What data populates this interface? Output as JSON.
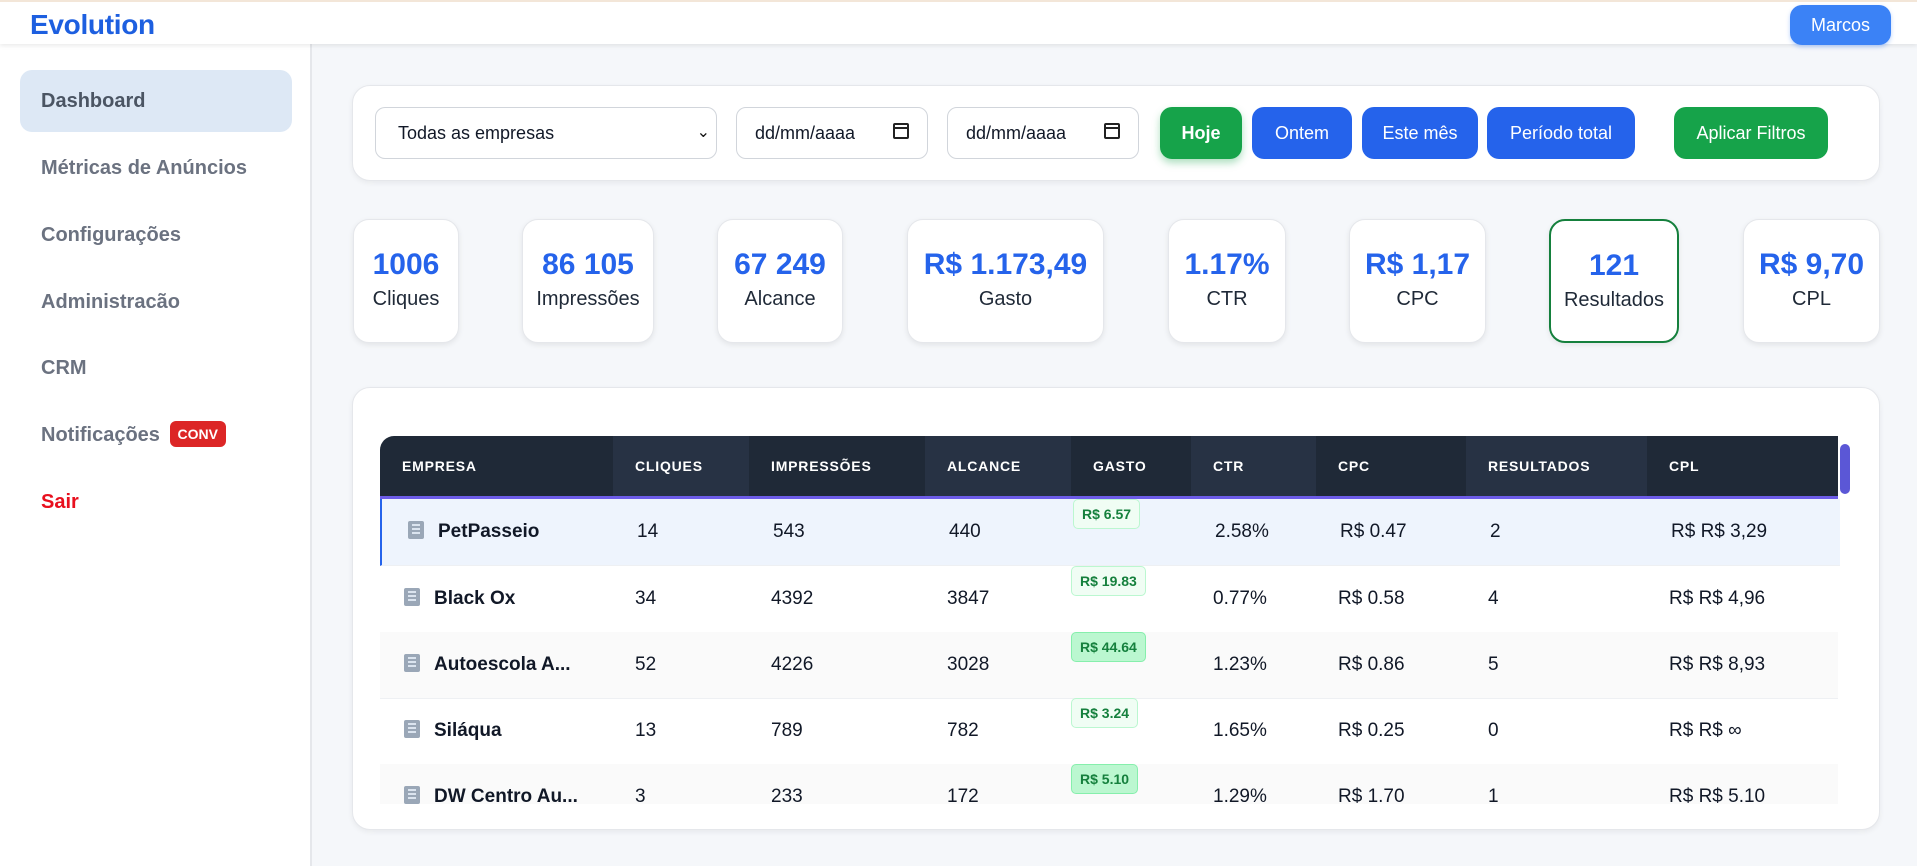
{
  "app": {
    "brand": "Evolution",
    "user": "Marcos"
  },
  "sidebar": {
    "items": [
      {
        "label": "Dashboard"
      },
      {
        "label": "Métricas de Anúncios"
      },
      {
        "label": "Configurações"
      },
      {
        "label": "Administracão"
      },
      {
        "label": "CRM"
      },
      {
        "label": "Notificações",
        "badge": "CONV"
      },
      {
        "label": "Sair"
      }
    ]
  },
  "filters": {
    "company_select": "Todas as empresas",
    "date_from": "dd/mm/aaaa",
    "date_to": "dd/mm/aaaa",
    "buttons": {
      "today": "Hoje",
      "yesterday": "Ontem",
      "this_month": "Este mês",
      "full_period": "Período total",
      "apply": "Aplicar Filtros"
    }
  },
  "kpis": [
    {
      "value": "1006",
      "label": "Cliques"
    },
    {
      "value": "86 105",
      "label": "Impressões"
    },
    {
      "value": "67 249",
      "label": "Alcance"
    },
    {
      "value": "R$ 1.173,49",
      "label": "Gasto"
    },
    {
      "value": "1.17%",
      "label": "CTR"
    },
    {
      "value": "R$ 1,17",
      "label": "CPC"
    },
    {
      "value": "121",
      "label": "Resultados"
    },
    {
      "value": "R$ 9,70",
      "label": "CPL"
    }
  ],
  "table": {
    "columns": [
      "EMPRESA",
      "CLIQUES",
      "IMPRESSÕES",
      "ALCANCE",
      "GASTO",
      "CTR",
      "CPC",
      "RESULTADOS",
      "CPL"
    ],
    "rows": [
      {
        "empresa": "PetPasseio",
        "cliques": "14",
        "impressoes": "543",
        "alcance": "440",
        "gasto": "R$ 6.57",
        "ctr": "2.58%",
        "cpc": "R$ 0.47",
        "resultados": "2",
        "cpl": "R$ R$ 3,29"
      },
      {
        "empresa": "Black Ox",
        "cliques": "34",
        "impressoes": "4392",
        "alcance": "3847",
        "gasto": "R$ 19.83",
        "ctr": "0.77%",
        "cpc": "R$ 0.58",
        "resultados": "4",
        "cpl": "R$ R$ 4,96"
      },
      {
        "empresa": "Autoescola A...",
        "cliques": "52",
        "impressoes": "4226",
        "alcance": "3028",
        "gasto": "R$ 44.64",
        "ctr": "1.23%",
        "cpc": "R$ 0.86",
        "resultados": "5",
        "cpl": "R$ R$ 8,93"
      },
      {
        "empresa": "Siláqua",
        "cliques": "13",
        "impressoes": "789",
        "alcance": "782",
        "gasto": "R$ 3.24",
        "ctr": "1.65%",
        "cpc": "R$ 0.25",
        "resultados": "0",
        "cpl": "R$ R$ ∞"
      },
      {
        "empresa": "DW Centro Au...",
        "cliques": "3",
        "impressoes": "233",
        "alcance": "172",
        "gasto": "R$ 5.10",
        "ctr": "1.29%",
        "cpc": "R$ 1.70",
        "resultados": "1",
        "cpl": "R$ R$ 5.10"
      }
    ]
  }
}
